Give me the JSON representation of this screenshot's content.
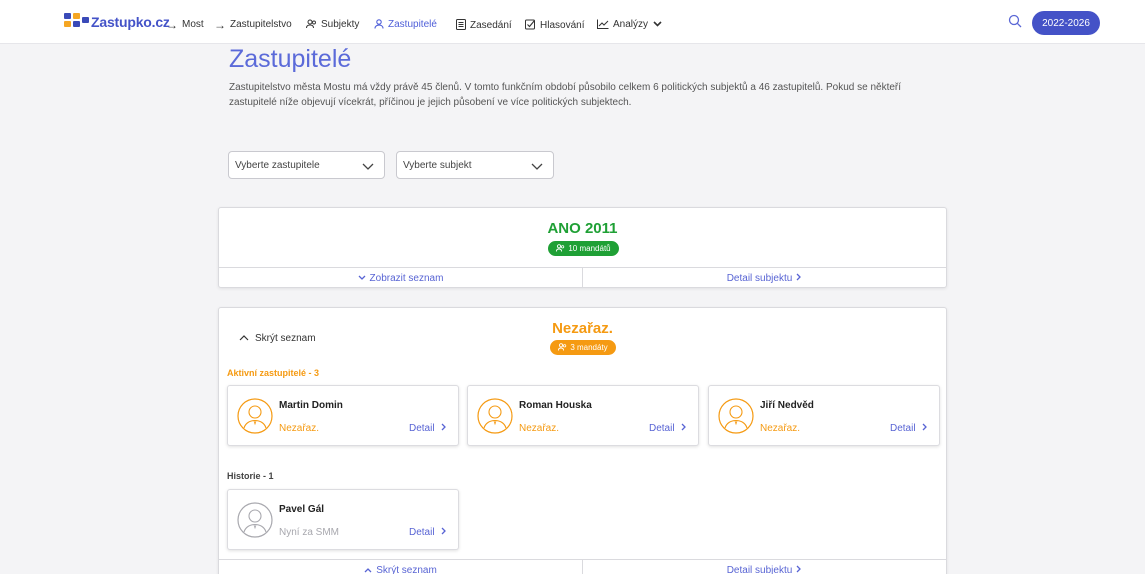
{
  "nav": {
    "logo_text": "Zastupko.cz",
    "items": [
      {
        "label": "Most",
        "icon": "arrow-right-icon"
      },
      {
        "label": "Zastupitelstvo",
        "icon": "arrow-right-icon"
      },
      {
        "label": "Subjekty",
        "icon": "users-icon"
      },
      {
        "label": "Zastupitelé",
        "icon": "user-icon"
      },
      {
        "label": "Zasedání",
        "icon": "document-icon"
      },
      {
        "label": "Hlasování",
        "icon": "checkbox-icon"
      },
      {
        "label": "Analýzy",
        "icon": "chart-icon"
      }
    ],
    "term_label": "2022-2026",
    "colors": {
      "accent": "#4452c7",
      "active": "#4e5ed8"
    }
  },
  "header": {
    "title": "Zastupitelé",
    "intro": "Zastupitelstvo města Mostu má vždy právě 45 členů. V tomto funkčním období působilo celkem 6 politických subjektů a 46 zastupitelů. Pokud se někteří zastupitelé níže objevují vícekrát, příčinou je jejich působení ve více politických subjektech."
  },
  "filters": {
    "member_placeholder": "Vyberte zastupitele",
    "party_placeholder": "Vyberte subjekt"
  },
  "parties": [
    {
      "name": "ANO 2011",
      "color": "#1fa035",
      "mandates": "10 mandátů",
      "show_list": "Zobrazit seznam",
      "detail": "Detail subjektu"
    },
    {
      "name": "Nezařaz.",
      "color": "#f59a12",
      "mandates": "3 mandáty",
      "hide_list": "Skrýt seznam",
      "active_label": "Aktivní zastupitelé - 3",
      "history_label": "Historie - 1",
      "members": [
        {
          "name": "Martin Domin",
          "party": "Nezařaz.",
          "detail": "Detail"
        },
        {
          "name": "Roman Houska",
          "party": "Nezařaz.",
          "detail": "Detail"
        },
        {
          "name": "Jiří Nedvěd",
          "party": "Nezařaz.",
          "detail": "Detail"
        }
      ],
      "history": [
        {
          "name": "Pavel Gál",
          "party": "Nyní za SMM",
          "detail": "Detail"
        }
      ],
      "hide_list_bottom": "Skrýt seznam",
      "detail": "Detail subjektu"
    }
  ]
}
